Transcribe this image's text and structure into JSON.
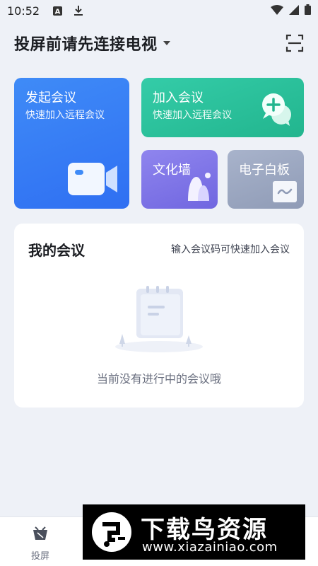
{
  "status_bar": {
    "time": "10:52"
  },
  "header": {
    "title": "投屏前请先连接电视"
  },
  "cards": {
    "start_meeting": {
      "title": "发起会议",
      "subtitle": "快速加入远程会议"
    },
    "join_meeting": {
      "title": "加入会议",
      "subtitle": "快速加入远程会议"
    },
    "culture_wall": {
      "title": "文化墙"
    },
    "whiteboard": {
      "title": "电子白板"
    }
  },
  "my_meetings": {
    "title": "我的会议",
    "link": "输入会议码可快速加入会议",
    "empty_text": "当前没有进行中的会议哦"
  },
  "bottom_bar": {
    "tab_cast_label": "投屏"
  },
  "watermark": {
    "title": "下载鸟资源",
    "url": "www.xiazainiao.com"
  },
  "colors": {
    "start_card": "#2f6ff2",
    "join_card": "#22b58e",
    "culture_card": "#7066e0",
    "whiteboard_card": "#8f9bb6",
    "background": "#eef1f7"
  },
  "icons": {
    "status": [
      "a-notification-icon",
      "download-icon",
      "wifi-icon",
      "signal-icon",
      "battery-icon"
    ],
    "header": [
      "dropdown-icon",
      "scan-icon"
    ],
    "cards": [
      "video-camera-icon",
      "chat-add-icon",
      "culture-wall-icon",
      "whiteboard-icon"
    ]
  }
}
